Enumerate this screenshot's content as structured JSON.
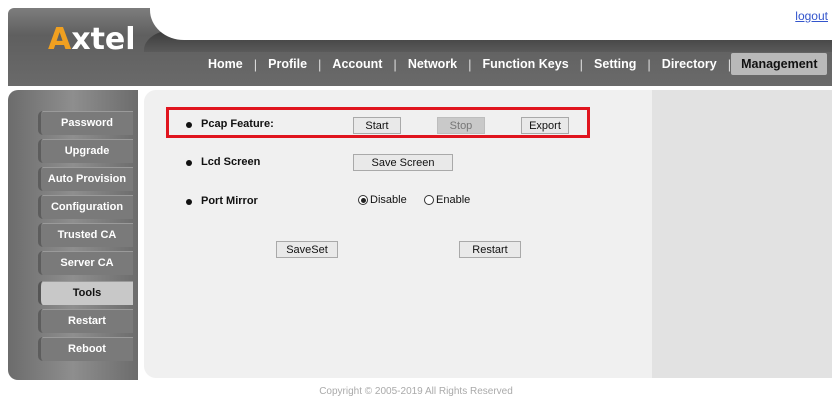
{
  "header": {
    "logo_text": "xtel",
    "logo_accent": "A",
    "logout": "logout",
    "nav": [
      "Home",
      "Profile",
      "Account",
      "Network",
      "Function Keys",
      "Setting",
      "Directory",
      "Management"
    ],
    "active_nav": "Management"
  },
  "sidebar": {
    "items": [
      "Password",
      "Upgrade",
      "Auto Provision",
      "Configuration",
      "Trusted CA",
      "Server CA",
      "Tools",
      "Restart",
      "Reboot"
    ],
    "active": "Tools"
  },
  "main": {
    "pcap": {
      "label": "Pcap Feature:",
      "start": "Start",
      "stop": "Stop",
      "export": "Export"
    },
    "lcd": {
      "label": "Lcd Screen",
      "save": "Save Screen"
    },
    "port_mirror": {
      "label": "Port Mirror",
      "disable": "Disable",
      "enable": "Enable",
      "selected": "Disable"
    },
    "saveset": "SaveSet",
    "restart": "Restart"
  },
  "footer": "Copyright © 2005-2019 All Rights Reserved",
  "colors": {
    "highlight": "#e0141e",
    "logo_accent": "#f0a020",
    "link": "#3355cc"
  }
}
